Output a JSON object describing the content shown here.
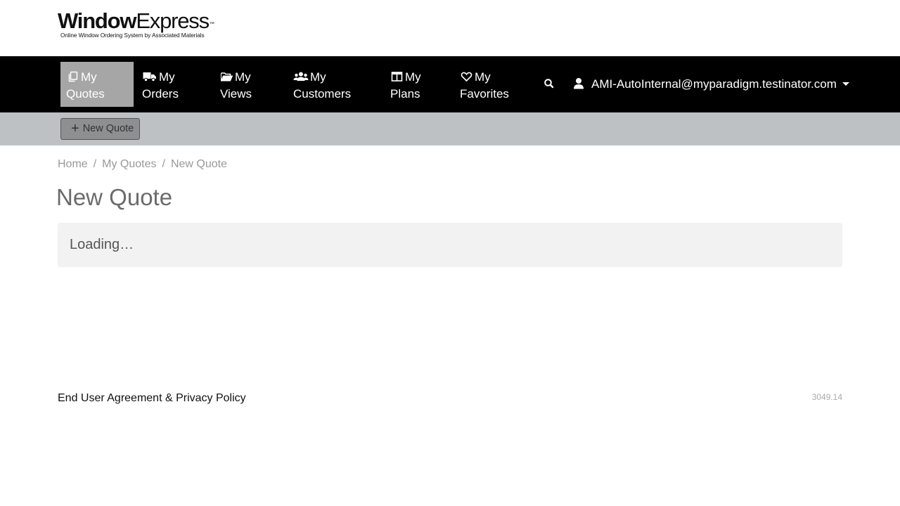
{
  "brand": {
    "logo_bold": "Window",
    "logo_light": "Express",
    "logo_tm": "™",
    "tagline": "Online Window Ordering System by Associated Materials"
  },
  "nav": {
    "items": [
      {
        "line1": "My",
        "line2": "Quotes",
        "icon": "copy-icon",
        "active": true
      },
      {
        "line1": "My",
        "line2": "Orders",
        "icon": "truck-icon",
        "active": false
      },
      {
        "line1": "My",
        "line2": "Views",
        "icon": "folder-open-icon",
        "active": false
      },
      {
        "line1": "My",
        "line2": "Customers",
        "icon": "users-icon",
        "active": false
      },
      {
        "line1": "My",
        "line2": "Plans",
        "icon": "columns-icon",
        "active": false
      },
      {
        "line1": "My",
        "line2": "Favorites",
        "icon": "heart-icon",
        "active": false
      }
    ],
    "search_icon": "search-icon",
    "user_email": "AMI-AutoInternal@myparadigm.testinator.com"
  },
  "toolbar": {
    "new_quote_label": "New Quote"
  },
  "breadcrumb": {
    "home": "Home",
    "my_quotes": "My Quotes",
    "current": "New Quote",
    "separator": "/"
  },
  "page": {
    "title": "New Quote",
    "loading_text": "Loading…"
  },
  "footer": {
    "agreement_link": "End User Agreement & Privacy Policy",
    "version": "3049.14"
  },
  "colors": {
    "nav_bg": "#000000",
    "nav_active_bg": "#a6a6a6",
    "toolbar_bg": "#bec1c4",
    "panel_bg": "#f1f2f1"
  }
}
